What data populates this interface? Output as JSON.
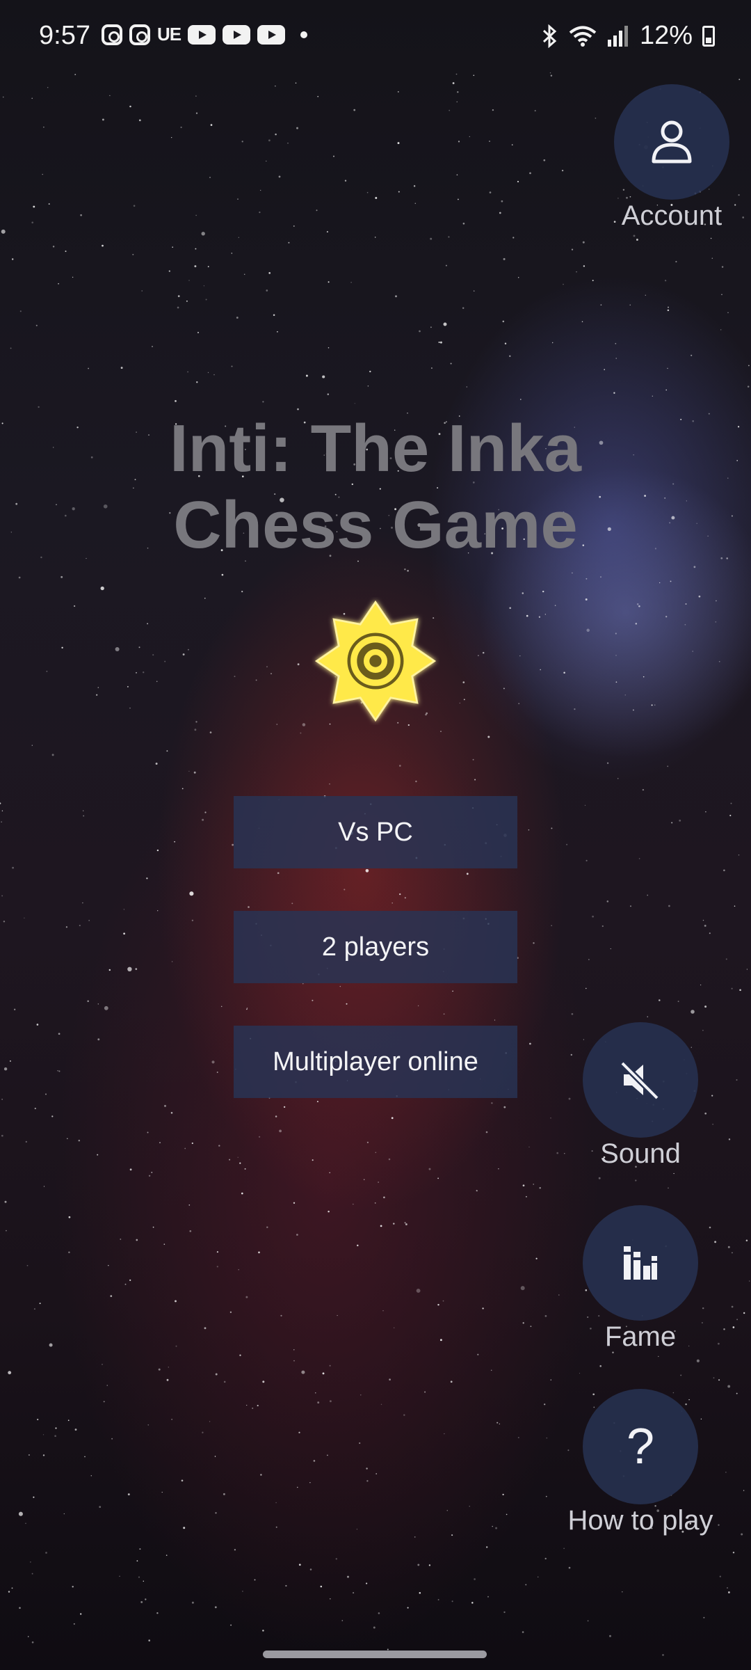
{
  "status_bar": {
    "time": "9:57",
    "carrier_badge": "UE",
    "battery_percent": "12%",
    "icons": [
      "instagram-icon",
      "instagram-icon",
      "youtube-icon",
      "youtube-icon",
      "youtube-icon",
      "bluetooth-icon",
      "wifi-icon",
      "signal-icon",
      "battery-charging-icon"
    ]
  },
  "app": {
    "title_line1": "Inti: The Inka",
    "title_line2": "Chess Game",
    "logo": "sun-icon"
  },
  "menu": {
    "vs_pc": "Vs PC",
    "two_players": "2 players",
    "multiplayer": "Multiplayer online"
  },
  "side_buttons": {
    "account": {
      "label": "Account",
      "icon": "user-icon"
    },
    "sound": {
      "label": "Sound",
      "icon": "speaker-muted-icon"
    },
    "fame": {
      "label": "Fame",
      "icon": "leaderboard-icon"
    },
    "how_to_play": {
      "label": "How to play",
      "icon": "question-mark-icon",
      "glyph": "?"
    }
  },
  "colors": {
    "button_bg": "#28344f",
    "title": "#78777d",
    "sun": "#ffe94a"
  }
}
